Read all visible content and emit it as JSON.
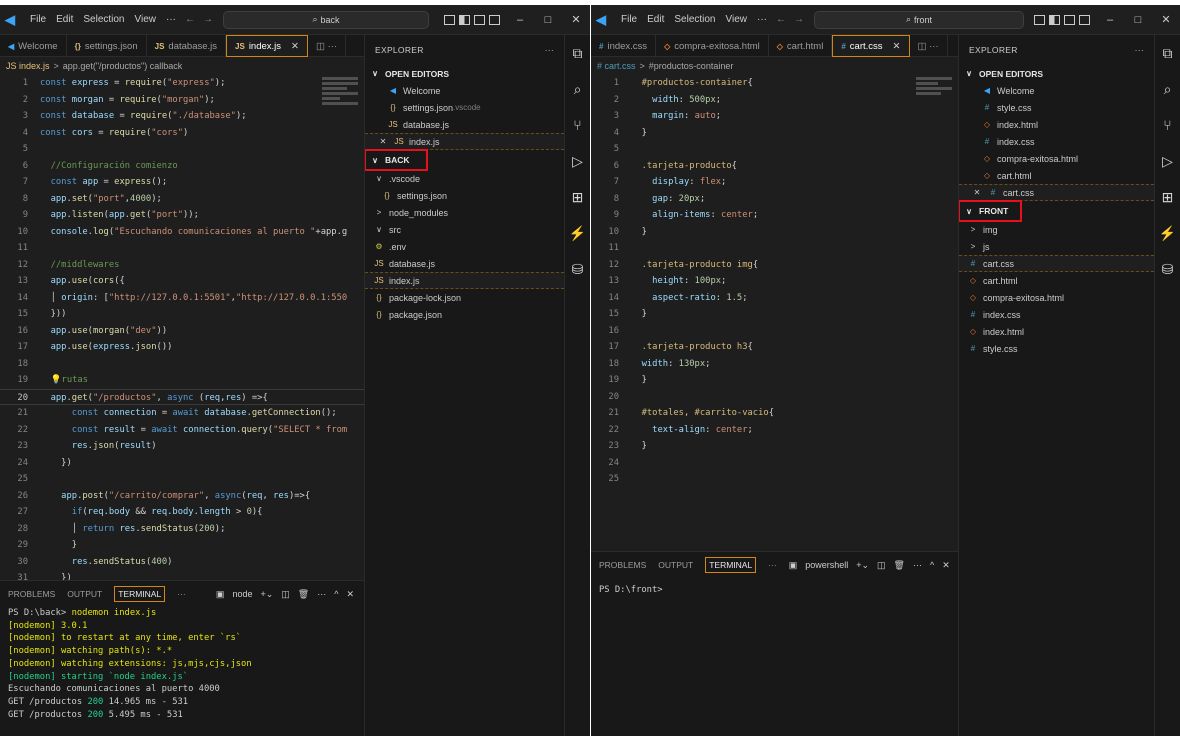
{
  "menu": {
    "file": "File",
    "edit": "Edit",
    "selection": "Selection",
    "view": "View",
    "more": "···"
  },
  "left": {
    "search": "back",
    "tabs": [
      {
        "icon": "vscode-icon",
        "label": "Welcome"
      },
      {
        "icon": "json-icon",
        "label": "settings.json"
      },
      {
        "icon": "js-icon",
        "label": "database.js"
      },
      {
        "icon": "js-icon",
        "label": "index.js",
        "active": true
      }
    ],
    "breadcrumb": {
      "file": "JS index.js",
      "sep": ">",
      "symbol": "app.get(\"/productos\") callback"
    },
    "panel": {
      "problems": "PROBLEMS",
      "output": "OUTPUT",
      "terminal": "TERMINAL",
      "more": "···",
      "shell": "node"
    },
    "terminal": [
      {
        "c": "wt",
        "t": ""
      },
      {
        "c": "wt",
        "t": "PS D:\\back> ",
        "y": "nodemon index.js"
      },
      {
        "c": "yl",
        "t": "[nodemon] 3.0.1"
      },
      {
        "c": "yl",
        "t": "[nodemon] to restart at any time, enter `rs`"
      },
      {
        "c": "yl",
        "t": "[nodemon] watching path(s): *.*"
      },
      {
        "c": "yl",
        "t": "[nodemon] watching extensions: js,mjs,cjs,json"
      },
      {
        "c": "gr",
        "t": "[nodemon] starting `node index.js`"
      },
      {
        "c": "wt",
        "t": "Escuchando comunicaciones al puerto 4000"
      },
      {
        "c": "wt",
        "t": "GET /productos ",
        "g": "200",
        "r": " 14.965 ms - 531"
      },
      {
        "c": "wt",
        "t": "GET /productos ",
        "g": "200",
        "r": " 5.495 ms - 531"
      }
    ],
    "explorer": {
      "title": "EXPLORER",
      "more": "···",
      "open_editors": "OPEN EDITORS",
      "open": [
        {
          "icon": "i-vs",
          "glyph": "◀",
          "label": "Welcome"
        },
        {
          "icon": "i-json",
          "glyph": "{}",
          "label": "settings.json",
          "hint": ".vscode"
        },
        {
          "icon": "i-js",
          "glyph": "JS",
          "label": "database.js"
        },
        {
          "icon": "i-js",
          "glyph": "JS",
          "label": "index.js",
          "close": true
        }
      ],
      "folder": "BACK",
      "tree": [
        {
          "icon": "",
          "glyph": "∨",
          "label": ".vscode",
          "indent": 1
        },
        {
          "icon": "i-json",
          "glyph": "{}",
          "label": "settings.json",
          "indent": 2
        },
        {
          "icon": "",
          "glyph": ">",
          "label": "node_modules",
          "indent": 1
        },
        {
          "icon": "",
          "glyph": "∨",
          "label": "src",
          "indent": 1
        },
        {
          "icon": "i-env",
          "glyph": "⚙",
          "label": ".env",
          "indent": 1
        },
        {
          "icon": "i-js",
          "glyph": "JS",
          "label": "database.js",
          "indent": 1
        },
        {
          "icon": "i-js",
          "glyph": "JS",
          "label": "index.js",
          "indent": 1,
          "sel": true
        },
        {
          "icon": "i-json",
          "glyph": "{}",
          "label": "package-lock.json",
          "indent": 1
        },
        {
          "icon": "i-json",
          "glyph": "{}",
          "label": "package.json",
          "indent": 1
        }
      ]
    }
  },
  "right": {
    "search": "front",
    "tabs": [
      {
        "icon": "css-icon",
        "label": "index.css"
      },
      {
        "icon": "html-icon",
        "label": "compra-exitosa.html"
      },
      {
        "icon": "html-icon",
        "label": "cart.html"
      },
      {
        "icon": "css-icon",
        "label": "cart.css",
        "active": true
      }
    ],
    "breadcrumb": {
      "file": "# cart.css",
      "sep": ">",
      "symbol": "#productos-container"
    },
    "panel": {
      "problems": "PROBLEMS",
      "output": "OUTPUT",
      "terminal": "TERMINAL",
      "more": "···",
      "shell": "powershell"
    },
    "terminal_line": "PS D:\\front>",
    "explorer": {
      "title": "EXPLORER",
      "more": "···",
      "open_editors": "OPEN EDITORS",
      "open": [
        {
          "icon": "i-vs",
          "glyph": "◀",
          "label": "Welcome"
        },
        {
          "icon": "i-css",
          "glyph": "#",
          "label": "style.css"
        },
        {
          "icon": "i-html",
          "glyph": "◇",
          "label": "index.html"
        },
        {
          "icon": "i-css",
          "glyph": "#",
          "label": "index.css"
        },
        {
          "icon": "i-html",
          "glyph": "◇",
          "label": "compra-exitosa.html"
        },
        {
          "icon": "i-html",
          "glyph": "◇",
          "label": "cart.html"
        },
        {
          "icon": "i-css",
          "glyph": "#",
          "label": "cart.css",
          "close": true
        }
      ],
      "folder": "FRONT",
      "tree": [
        {
          "icon": "",
          "glyph": ">",
          "label": "img",
          "indent": 1
        },
        {
          "icon": "",
          "glyph": ">",
          "label": "js",
          "indent": 1
        },
        {
          "icon": "i-css",
          "glyph": "#",
          "label": "cart.css",
          "indent": 1,
          "sel": true
        },
        {
          "icon": "i-html",
          "glyph": "◇",
          "label": "cart.html",
          "indent": 1
        },
        {
          "icon": "i-html",
          "glyph": "◇",
          "label": "compra-exitosa.html",
          "indent": 1
        },
        {
          "icon": "i-css",
          "glyph": "#",
          "label": "index.css",
          "indent": 1
        },
        {
          "icon": "i-html",
          "glyph": "◇",
          "label": "index.html",
          "indent": 1
        },
        {
          "icon": "i-css",
          "glyph": "#",
          "label": "style.css",
          "indent": 1
        }
      ]
    }
  },
  "js_code": [
    [
      [
        "kw",
        "const "
      ],
      [
        "vr",
        "express"
      ],
      [
        "pl",
        " = "
      ],
      [
        "fn",
        "require"
      ],
      [
        "pl",
        "("
      ],
      [
        "st",
        "\"express\""
      ],
      [
        "pl",
        ");"
      ]
    ],
    [
      [
        "kw",
        "const "
      ],
      [
        "vr",
        "morgan"
      ],
      [
        "pl",
        " = "
      ],
      [
        "fn",
        "require"
      ],
      [
        "pl",
        "("
      ],
      [
        "st",
        "\"morgan\""
      ],
      [
        "pl",
        ");"
      ]
    ],
    [
      [
        "kw",
        "const "
      ],
      [
        "vr",
        "database"
      ],
      [
        "pl",
        " = "
      ],
      [
        "fn",
        "require"
      ],
      [
        "pl",
        "("
      ],
      [
        "st",
        "\"./database\""
      ],
      [
        "pl",
        ");"
      ]
    ],
    [
      [
        "kw",
        "const "
      ],
      [
        "vr",
        "cors"
      ],
      [
        "pl",
        " = "
      ],
      [
        "fn",
        "require"
      ],
      [
        "pl",
        "("
      ],
      [
        "st",
        "\"cors\""
      ],
      [
        "pl",
        ")"
      ]
    ],
    [],
    [
      [
        "cm",
        "  //Configuración comienzo"
      ]
    ],
    [
      [
        "kw",
        "  const "
      ],
      [
        "vr",
        "app"
      ],
      [
        "pl",
        " = "
      ],
      [
        "fn",
        "express"
      ],
      [
        "pl",
        "();"
      ]
    ],
    [
      [
        "vr",
        "  app"
      ],
      [
        "pl",
        "."
      ],
      [
        "fn",
        "set"
      ],
      [
        "pl",
        "("
      ],
      [
        "st",
        "\"port\""
      ],
      [
        "pl",
        ","
      ],
      [
        "nm",
        "4000"
      ],
      [
        "pl",
        ");"
      ]
    ],
    [
      [
        "vr",
        "  app"
      ],
      [
        "pl",
        "."
      ],
      [
        "fn",
        "listen"
      ],
      [
        "pl",
        "("
      ],
      [
        "vr",
        "app"
      ],
      [
        "pl",
        "."
      ],
      [
        "fn",
        "get"
      ],
      [
        "pl",
        "("
      ],
      [
        "st",
        "\"port\""
      ],
      [
        "pl",
        "));"
      ]
    ],
    [
      [
        "vr",
        "  console"
      ],
      [
        "pl",
        "."
      ],
      [
        "fn",
        "log"
      ],
      [
        "pl",
        "("
      ],
      [
        "st",
        "\"Escuchando comunicaciones al puerto \""
      ],
      [
        "pl",
        "+app.g"
      ]
    ],
    [],
    [
      [
        "cm",
        "  //middlewares"
      ]
    ],
    [
      [
        "vr",
        "  app"
      ],
      [
        "pl",
        "."
      ],
      [
        "fn",
        "use"
      ],
      [
        "pl",
        "("
      ],
      [
        "fn",
        "cors"
      ],
      [
        "pl",
        "({"
      ]
    ],
    [
      [
        "pl",
        "  │ "
      ],
      [
        "vr",
        "origin"
      ],
      [
        "pl",
        ": ["
      ],
      [
        "st",
        "\"http://127.0.0.1:5501\""
      ],
      [
        "pl",
        ","
      ],
      [
        "st",
        "\"http://127.0.0.1:550"
      ]
    ],
    [
      [
        "pl",
        "  }))"
      ]
    ],
    [
      [
        "vr",
        "  app"
      ],
      [
        "pl",
        "."
      ],
      [
        "fn",
        "use"
      ],
      [
        "pl",
        "("
      ],
      [
        "fn",
        "morgan"
      ],
      [
        "pl",
        "("
      ],
      [
        "st",
        "\"dev\""
      ],
      [
        "pl",
        "))"
      ]
    ],
    [
      [
        "vr",
        "  app"
      ],
      [
        "pl",
        "."
      ],
      [
        "fn",
        "use"
      ],
      [
        "pl",
        "("
      ],
      [
        "vr",
        "express"
      ],
      [
        "pl",
        "."
      ],
      [
        "fn",
        "json"
      ],
      [
        "pl",
        "())"
      ]
    ],
    [],
    [
      [
        "cls",
        "  💡"
      ],
      [
        "cm",
        "rutas"
      ]
    ],
    [
      [
        "vr",
        "  app"
      ],
      [
        "pl",
        "."
      ],
      [
        "fn",
        "get"
      ],
      [
        "pl",
        "("
      ],
      [
        "st",
        "\"/productos\""
      ],
      [
        "pl",
        ", "
      ],
      [
        "kw",
        "async"
      ],
      [
        "pl",
        " ("
      ],
      [
        "vr",
        "req"
      ],
      [
        "pl",
        ","
      ],
      [
        "vr",
        "res"
      ],
      [
        "pl",
        ") =>{"
      ]
    ],
    [
      [
        "kw",
        "      const "
      ],
      [
        "vr",
        "connection"
      ],
      [
        "pl",
        " = "
      ],
      [
        "kw",
        "await "
      ],
      [
        "vr",
        "database"
      ],
      [
        "pl",
        "."
      ],
      [
        "fn",
        "getConnection"
      ],
      [
        "pl",
        "();"
      ]
    ],
    [
      [
        "kw",
        "      const "
      ],
      [
        "vr",
        "result"
      ],
      [
        "pl",
        " = "
      ],
      [
        "kw",
        "await "
      ],
      [
        "vr",
        "connection"
      ],
      [
        "pl",
        "."
      ],
      [
        "fn",
        "query"
      ],
      [
        "pl",
        "("
      ],
      [
        "st",
        "\"SELECT * from"
      ]
    ],
    [
      [
        "vr",
        "      res"
      ],
      [
        "pl",
        "."
      ],
      [
        "fn",
        "json"
      ],
      [
        "pl",
        "("
      ],
      [
        "vr",
        "result"
      ],
      [
        "pl",
        ")"
      ]
    ],
    [
      [
        "pl",
        "    })"
      ]
    ],
    [],
    [
      [
        "vr",
        "    app"
      ],
      [
        "pl",
        "."
      ],
      [
        "fn",
        "post"
      ],
      [
        "pl",
        "("
      ],
      [
        "st",
        "\"/carrito/comprar\""
      ],
      [
        "pl",
        ", "
      ],
      [
        "kw",
        "async"
      ],
      [
        "pl",
        "("
      ],
      [
        "vr",
        "req"
      ],
      [
        "pl",
        ", "
      ],
      [
        "vr",
        "res"
      ],
      [
        "pl",
        ")=>{"
      ]
    ],
    [
      [
        "kw",
        "      if"
      ],
      [
        "pl",
        "("
      ],
      [
        "vr",
        "req"
      ],
      [
        "pl",
        "."
      ],
      [
        "vr",
        "body"
      ],
      [
        "pl",
        " && "
      ],
      [
        "vr",
        "req"
      ],
      [
        "pl",
        "."
      ],
      [
        "vr",
        "body"
      ],
      [
        "pl",
        "."
      ],
      [
        "vr",
        "length"
      ],
      [
        "pl",
        " > "
      ],
      [
        "nm",
        "0"
      ],
      [
        "pl",
        "){"
      ]
    ],
    [
      [
        "pl",
        "      │ "
      ],
      [
        "kw",
        "return "
      ],
      [
        "vr",
        "res"
      ],
      [
        "pl",
        "."
      ],
      [
        "fn",
        "sendStatus"
      ],
      [
        "pl",
        "("
      ],
      [
        "nm",
        "200"
      ],
      [
        "pl",
        ");"
      ]
    ],
    [
      [
        "pl",
        "      }"
      ]
    ],
    [
      [
        "vr",
        "      res"
      ],
      [
        "pl",
        "."
      ],
      [
        "fn",
        "sendStatus"
      ],
      [
        "pl",
        "("
      ],
      [
        "nm",
        "400"
      ],
      [
        "pl",
        ")"
      ]
    ],
    [
      [
        "pl",
        "    })"
      ]
    ]
  ],
  "css_code": [
    [
      [
        "cls",
        "  #productos-container"
      ],
      [
        "pl",
        "{"
      ]
    ],
    [
      [
        "prop",
        "    width"
      ],
      [
        "pl",
        ": "
      ],
      [
        "nm",
        "500px"
      ],
      [
        "pl",
        ";"
      ]
    ],
    [
      [
        "prop",
        "    margin"
      ],
      [
        "pl",
        ": "
      ],
      [
        "st",
        "auto"
      ],
      [
        "pl",
        ";"
      ]
    ],
    [
      [
        "pl",
        "  }"
      ]
    ],
    [],
    [
      [
        "cls",
        "  .tarjeta-producto"
      ],
      [
        "pl",
        "{"
      ]
    ],
    [
      [
        "prop",
        "    display"
      ],
      [
        "pl",
        ": "
      ],
      [
        "st",
        "flex"
      ],
      [
        "pl",
        ";"
      ]
    ],
    [
      [
        "prop",
        "    gap"
      ],
      [
        "pl",
        ": "
      ],
      [
        "nm",
        "20px"
      ],
      [
        "pl",
        ";"
      ]
    ],
    [
      [
        "prop",
        "    align-items"
      ],
      [
        "pl",
        ": "
      ],
      [
        "st",
        "center"
      ],
      [
        "pl",
        ";"
      ]
    ],
    [
      [
        "pl",
        "  }"
      ]
    ],
    [],
    [
      [
        "cls",
        "  .tarjeta-producto img"
      ],
      [
        "pl",
        "{"
      ]
    ],
    [
      [
        "prop",
        "    height"
      ],
      [
        "pl",
        ": "
      ],
      [
        "nm",
        "100px"
      ],
      [
        "pl",
        ";"
      ]
    ],
    [
      [
        "prop",
        "    aspect-ratio"
      ],
      [
        "pl",
        ": "
      ],
      [
        "nm",
        "1.5"
      ],
      [
        "pl",
        ";"
      ]
    ],
    [
      [
        "pl",
        "  }"
      ]
    ],
    [],
    [
      [
        "cls",
        "  .tarjeta-producto h3"
      ],
      [
        "pl",
        "{"
      ]
    ],
    [
      [
        "prop",
        "  width"
      ],
      [
        "pl",
        ": "
      ],
      [
        "nm",
        "130px"
      ],
      [
        "pl",
        ";"
      ]
    ],
    [
      [
        "pl",
        "  }"
      ]
    ],
    [],
    [
      [
        "cls",
        "  #totales, #carrito-vacio"
      ],
      [
        "pl",
        "{"
      ]
    ],
    [
      [
        "prop",
        "    text-align"
      ],
      [
        "pl",
        ": "
      ],
      [
        "st",
        "center"
      ],
      [
        "pl",
        ";"
      ]
    ],
    [
      [
        "pl",
        "  }"
      ]
    ],
    [],
    []
  ]
}
